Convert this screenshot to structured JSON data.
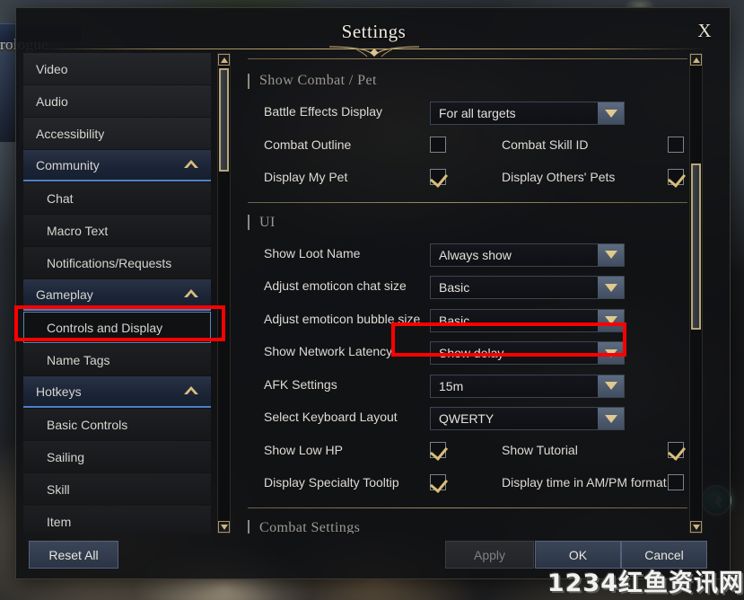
{
  "window": {
    "title": "Settings",
    "close_label": "X"
  },
  "background": {
    "hud_text": "rologue"
  },
  "sidebar": {
    "items": [
      {
        "label": "Video",
        "type": "item"
      },
      {
        "label": "Audio",
        "type": "item"
      },
      {
        "label": "Accessibility",
        "type": "item"
      },
      {
        "label": "Community",
        "type": "group",
        "expanded": true
      },
      {
        "label": "Chat",
        "type": "child"
      },
      {
        "label": "Macro Text",
        "type": "child"
      },
      {
        "label": "Notifications/Requests",
        "type": "child"
      },
      {
        "label": "Gameplay",
        "type": "group",
        "expanded": true
      },
      {
        "label": "Controls and Display",
        "type": "child",
        "selected": true
      },
      {
        "label": "Name Tags",
        "type": "child"
      },
      {
        "label": "Hotkeys",
        "type": "group",
        "expanded": true
      },
      {
        "label": "Basic Controls",
        "type": "child"
      },
      {
        "label": "Sailing",
        "type": "child"
      },
      {
        "label": "Skill",
        "type": "child"
      },
      {
        "label": "Item",
        "type": "child"
      }
    ]
  },
  "content": {
    "sections": [
      {
        "title": "Show Combat / Pet",
        "rows": [
          {
            "kind": "dropdown",
            "label": "Battle Effects Display",
            "value": "For all targets"
          },
          {
            "kind": "checkpair",
            "label": "Combat Outline",
            "checked": false,
            "label2": "Combat Skill ID",
            "checked2": false
          },
          {
            "kind": "checkpair",
            "label": "Display My Pet",
            "checked": true,
            "label2": "Display Others' Pets",
            "checked2": true
          }
        ]
      },
      {
        "title": "UI",
        "rows": [
          {
            "kind": "dropdown",
            "label": "Show Loot Name",
            "value": "Always show"
          },
          {
            "kind": "dropdown",
            "label": "Adjust emoticon chat size",
            "value": "Basic"
          },
          {
            "kind": "dropdown",
            "label": "Adjust emoticon bubble size",
            "value": "Basic"
          },
          {
            "kind": "dropdown",
            "label": "Show Network Latency",
            "value": "Show delay",
            "highlighted": true
          },
          {
            "kind": "dropdown",
            "label": "AFK Settings",
            "value": "15m"
          },
          {
            "kind": "dropdown",
            "label": "Select Keyboard Layout",
            "value": "QWERTY"
          },
          {
            "kind": "checkpair",
            "label": "Show Low HP",
            "checked": true,
            "label2": "Show Tutorial",
            "checked2": true
          },
          {
            "kind": "checkpair",
            "label": "Display Specialty Tooltip",
            "checked": true,
            "label2": "Display time in AM/PM format",
            "checked2": false
          }
        ]
      },
      {
        "title": "Combat Settings",
        "rows": []
      }
    ]
  },
  "footer": {
    "reset_label": "Reset All",
    "apply_label": "Apply",
    "ok_label": "OK",
    "cancel_label": "Cancel"
  },
  "watermark": {
    "text": "1234红鱼资讯网"
  },
  "colors": {
    "gold": "#c8b07a",
    "accent_blue": "#4f7fc4",
    "annotation_red": "#fe0000",
    "check_gold": "#d9bd79"
  }
}
